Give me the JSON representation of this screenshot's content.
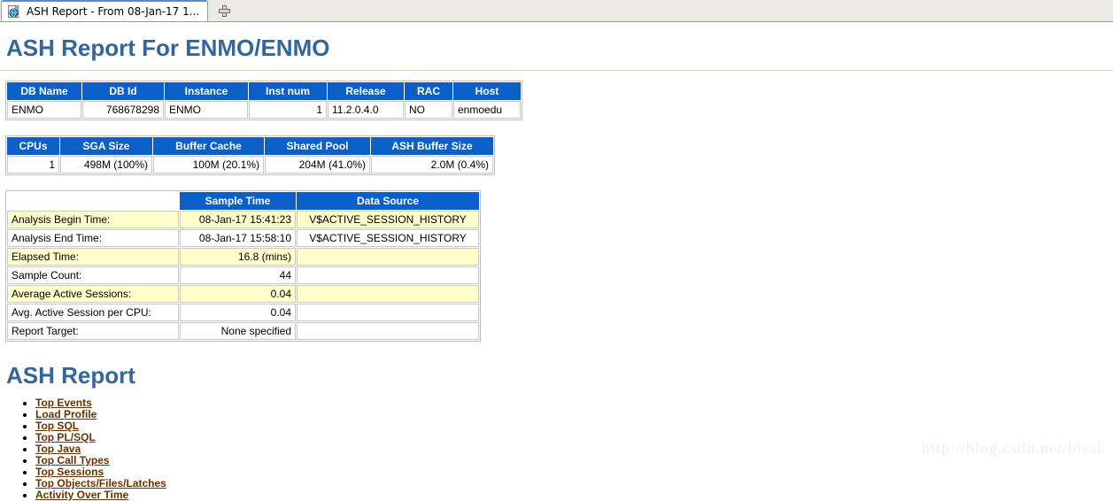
{
  "browser": {
    "tab": {
      "title": "ASH Report - From 08-Jan-17 1...",
      "favicon_name": "document-globe-icon"
    },
    "new_tab_label": "+"
  },
  "page": {
    "title": "ASH Report For ENMO/ENMO",
    "section_title": "ASH Report"
  },
  "db_info_table": {
    "headers": [
      "DB Name",
      "DB Id",
      "Instance",
      "Inst num",
      "Release",
      "RAC",
      "Host"
    ],
    "rows": [
      {
        "db_name": "ENMO",
        "db_id": "768678298",
        "instance": "ENMO",
        "inst_num": "1",
        "release": "11.2.0.4.0",
        "rac": "NO",
        "host": "enmoedu"
      }
    ]
  },
  "memory_table": {
    "headers": [
      "CPUs",
      "SGA Size",
      "Buffer Cache",
      "Shared Pool",
      "ASH Buffer Size"
    ],
    "rows": [
      {
        "cpus": "1",
        "sga_size": "498M (100%)",
        "buffer_cache": "100M (20.1%)",
        "shared_pool": "204M (41.0%)",
        "ash_buffer_size": "2.0M (0.4%)"
      }
    ]
  },
  "analysis_table": {
    "headers": [
      "",
      "Sample Time",
      "Data Source"
    ],
    "rows": [
      {
        "label": "Analysis Begin Time:",
        "sample_time": "08-Jan-17 15:41:23",
        "data_source": "V$ACTIVE_SESSION_HISTORY"
      },
      {
        "label": "Analysis End Time:",
        "sample_time": "08-Jan-17 15:58:10",
        "data_source": "V$ACTIVE_SESSION_HISTORY"
      },
      {
        "label": "Elapsed Time:",
        "sample_time": "16.8 (mins)",
        "data_source": ""
      },
      {
        "label": "Sample Count:",
        "sample_time": "44",
        "data_source": ""
      },
      {
        "label": "Average Active Sessions:",
        "sample_time": "0.04",
        "data_source": ""
      },
      {
        "label": "Avg. Active Session per CPU:",
        "sample_time": "0.04",
        "data_source": ""
      },
      {
        "label": "Report Target:",
        "sample_time": "None specified",
        "data_source": ""
      }
    ]
  },
  "toc": {
    "items": [
      "Top Events",
      "Load Profile",
      "Top SQL",
      "Top PL/SQL",
      "Top Java",
      "Top Call Types",
      "Top Sessions",
      "Top Objects/Files/Latches",
      "Activity Over Time"
    ]
  },
  "watermark": {
    "text": "http://blog.csdn.net/bisal"
  },
  "colors": {
    "header_blue": "#0b5fc8",
    "heading_blue": "#336699",
    "alt_row_yellow": "#ffffcc",
    "link_brown": "#663300",
    "rule_khaki": "#d9d2a8"
  }
}
